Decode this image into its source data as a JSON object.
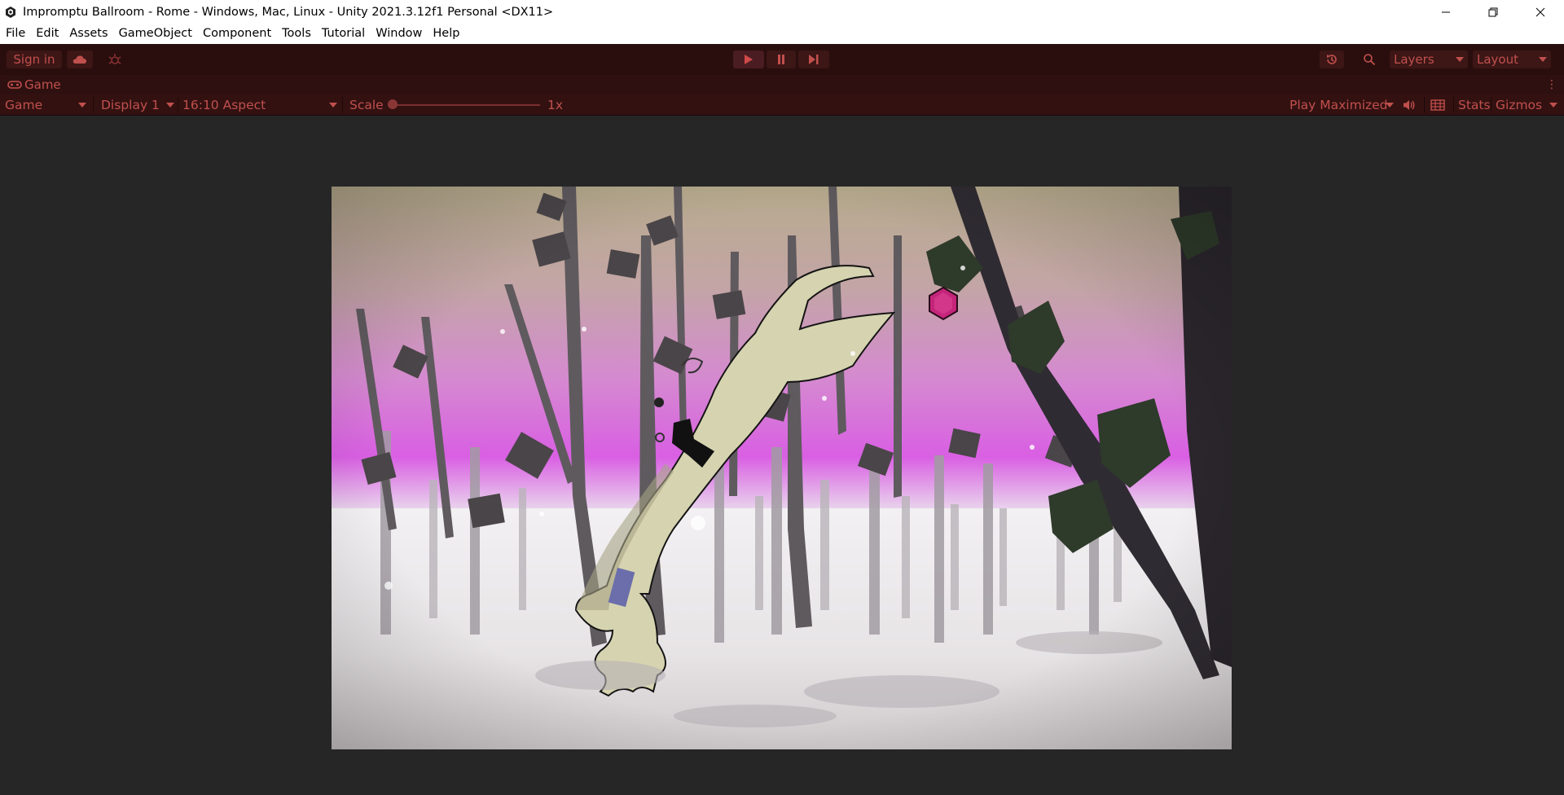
{
  "window": {
    "title": "Impromptu Ballroom - Rome - Windows, Mac, Linux - Unity 2021.3.12f1 Personal <DX11>",
    "app_icon": "unity-logo-icon",
    "controls": [
      "minimize-icon",
      "restore-icon",
      "close-icon"
    ]
  },
  "menu": {
    "items": [
      "File",
      "Edit",
      "Assets",
      "GameObject",
      "Component",
      "Tools",
      "Tutorial",
      "Window",
      "Help"
    ]
  },
  "toolbar": {
    "sign_in_label": "Sign in",
    "cloud_icon": "cloud-icon",
    "collab_icon": "collab-icon",
    "play_icon": "play-icon",
    "pause_icon": "pause-icon",
    "step_icon": "step-icon",
    "history_icon": "history-icon",
    "search_icon": "search-icon",
    "layers_label": "Layers",
    "layout_label": "Layout"
  },
  "game_tab": {
    "label": "Game",
    "icon": "gamepad-icon",
    "menu_icon": "kebab-menu-icon"
  },
  "game_options": {
    "view_mode": "Game",
    "display": "Display 1",
    "aspect": "16:10 Aspect",
    "scale_label": "Scale",
    "scale_value": "1x",
    "play_mode": "Play Maximized",
    "audio_icon": "speaker-icon",
    "grid_icon": "grid-icon",
    "stats_label": "Stats",
    "gizmos_label": "Gizmos"
  },
  "colors": {
    "playmode_tint": "#2a0e0e",
    "label_red": "#c0504d",
    "editor_bg": "#262626"
  }
}
